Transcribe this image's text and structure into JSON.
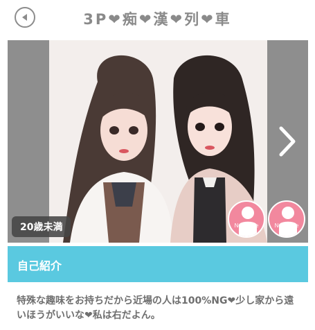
{
  "header": {
    "title": "3P❤痴❤漢❤列❤車",
    "back_icon": "chevron-left-circle-icon"
  },
  "slider": {
    "age_badge": "20歳未満",
    "next_icon": "chevron-right-icon",
    "thumbnails": [
      {
        "label": "No Image"
      },
      {
        "label": "No Image"
      }
    ]
  },
  "profile": {
    "section_title": "自己紹介",
    "intro_text": "特殊な趣味をお持ちだから近場の人は100%NG❤少し家から遠いほうがいいな❤私は右だよん。"
  },
  "colors": {
    "accent": "#5ac9e0",
    "noimage": "#f2889e",
    "text": "#6f6f6f"
  }
}
